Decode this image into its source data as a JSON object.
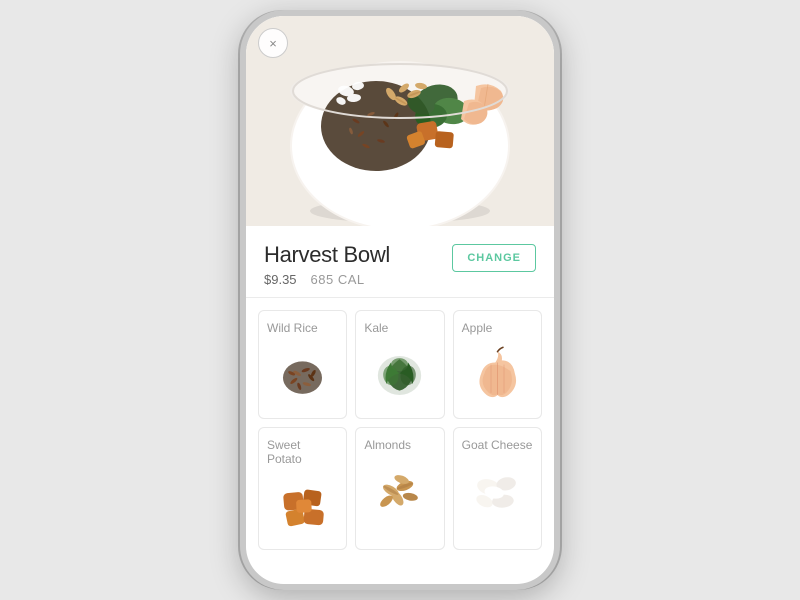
{
  "phone": {
    "close_icon": "×"
  },
  "product": {
    "name": "Harvest Bowl",
    "price": "$9.35",
    "calories": "685  CAL",
    "change_label": "CHANGE"
  },
  "ingredients": [
    {
      "id": "wild-rice",
      "name": "Wild Rice",
      "color_main": "#8B5E3C",
      "color_accent": "#5C3A1A"
    },
    {
      "id": "kale",
      "name": "Kale",
      "color_main": "#4a7c3f",
      "color_accent": "#2d5a27"
    },
    {
      "id": "apple",
      "name": "Apple",
      "color_main": "#e8c4b0",
      "color_accent": "#d4845a"
    },
    {
      "id": "sweet-potato",
      "name": "Sweet Potato",
      "color_main": "#c8702a",
      "color_accent": "#a8551a"
    },
    {
      "id": "almonds",
      "name": "Almonds",
      "color_main": "#d4a96a",
      "color_accent": "#b8874a"
    },
    {
      "id": "goat-cheese",
      "name": "Goat Cheese",
      "color_main": "#f0ece8",
      "color_accent": "#d8d0c8"
    }
  ]
}
